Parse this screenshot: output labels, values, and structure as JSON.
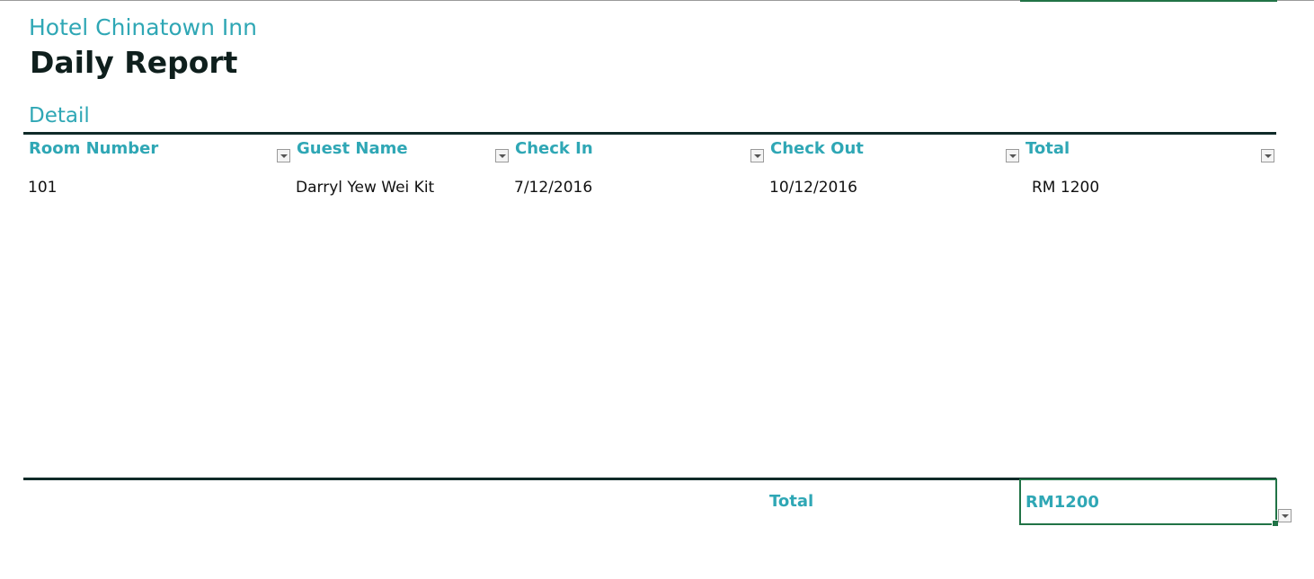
{
  "report": {
    "hotel_name": "Hotel Chinatown Inn",
    "title": "Daily Report",
    "section": "Detail"
  },
  "table": {
    "columns": [
      {
        "label": "Room Number"
      },
      {
        "label": "Guest Name"
      },
      {
        "label": "Check In"
      },
      {
        "label": "Check Out"
      },
      {
        "label": "Total"
      }
    ],
    "rows": [
      {
        "room_number": "101",
        "guest_name": "Darryl Yew Wei Kit",
        "check_in": "7/12/2016",
        "check_out": "10/12/2016",
        "total": "RM 1200"
      }
    ]
  },
  "summary": {
    "label": "Total",
    "value": "RM1200"
  },
  "colors": {
    "accent": "#2fa7b5",
    "heading": "#0f1f1d",
    "selection": "#217346"
  },
  "icons": {
    "filter": "chevron-down-icon",
    "fill_handle": "fill-handle"
  }
}
